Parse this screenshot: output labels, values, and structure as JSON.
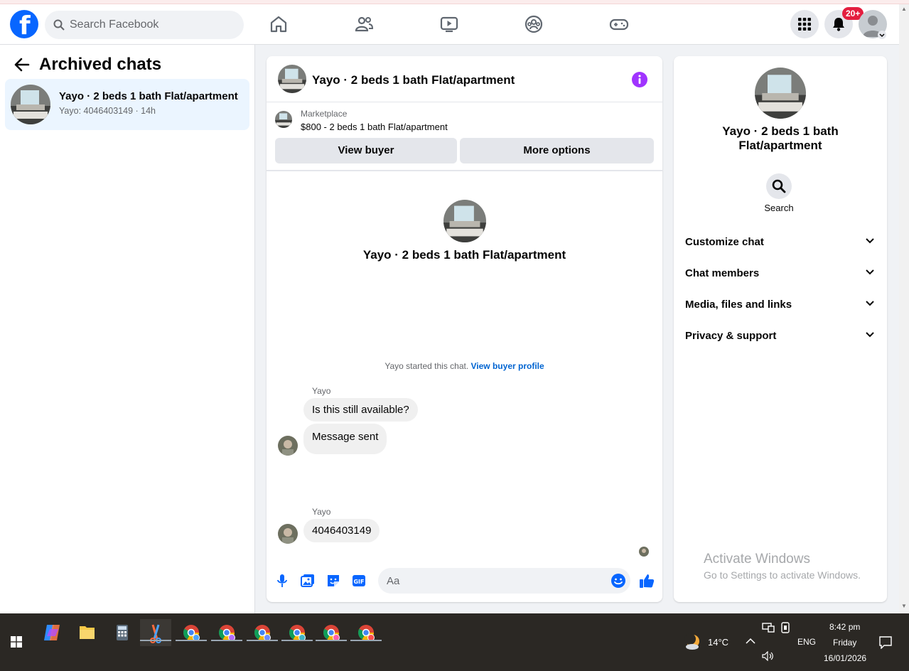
{
  "topbar": {
    "logo_letter": "f",
    "search_placeholder": "Search Facebook",
    "notification_badge": "20+"
  },
  "left": {
    "title": "Archived chats",
    "chat": {
      "name": "Yayo · 2 beds 1 bath Flat/apartment",
      "sub": "Yayo: 4046403149 · 14h"
    }
  },
  "conversation": {
    "title": "Yayo · 2 beds 1 bath Flat/apartment",
    "marketplace_label": "Marketplace",
    "marketplace_item": "$800 - 2 beds 1 bath Flat/apartment",
    "view_buyer": "View buyer",
    "more_options": "More options",
    "intro_title": "Yayo · 2 beds 1 bath Flat/apartment",
    "started_text": "Yayo started this chat.",
    "started_link": "View buyer profile",
    "messages": [
      {
        "sender": "Yayo",
        "text": "Is this still available?"
      },
      {
        "text": "Message sent"
      },
      {
        "sender": "Yayo",
        "text": "4046403149"
      }
    ],
    "composer_placeholder": "Aa"
  },
  "right": {
    "title": "Yayo · 2 beds 1 bath Flat/apartment",
    "search_label": "Search",
    "sections": [
      "Customize chat",
      "Chat members",
      "Media, files and links",
      "Privacy & support"
    ]
  },
  "watermark": {
    "line1": "Activate Windows",
    "line2": "Go to Settings to activate Windows."
  },
  "taskbar": {
    "temperature": "14°C",
    "language": "ENG",
    "time": "8:42 pm",
    "day": "Friday",
    "date": "16/01/2026"
  },
  "colors": {
    "brand": "#0866ff",
    "badge": "#e41e3f",
    "selected": "#ebf5ff",
    "info": "#a033ff"
  }
}
